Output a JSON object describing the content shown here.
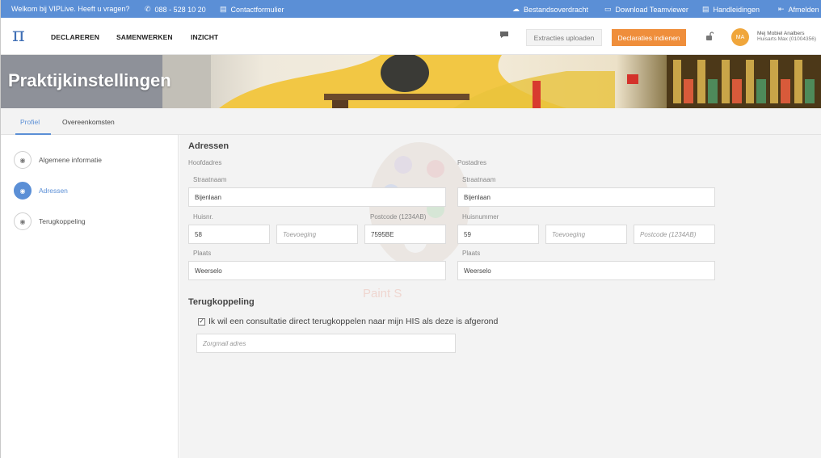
{
  "topbar": {
    "welcome": "Welkom bij VIPLive. Heeft u vragen?",
    "phone": "088 - 528 10 20",
    "contact": "Contactformulier",
    "transfer": "Bestandsoverdracht",
    "teamviewer": "Download Teamviewer",
    "manuals": "Handleidingen",
    "logout": "Afmelden"
  },
  "nav": {
    "logo": "π",
    "links": [
      "DECLAREREN",
      "SAMENWERKEN",
      "INZICHT"
    ],
    "upload_button": "Extracties uploaden",
    "submit_button": "Declaraties indienen",
    "avatar_initials": "MA",
    "user_name": "Mej Mobiel Analbers",
    "user_role": "Huisarts Max (01004356)"
  },
  "banner": {
    "title": "Praktijkinstellingen"
  },
  "tabs": [
    {
      "label": "Profiel",
      "active": true
    },
    {
      "label": "Overeenkomsten",
      "active": false
    }
  ],
  "sidebar": {
    "items": [
      {
        "label": "Algemene informatie",
        "icon": "eye-icon",
        "active": false
      },
      {
        "label": "Adressen",
        "icon": "eye-icon",
        "active": true
      },
      {
        "label": "Terugkoppeling",
        "icon": "eye-icon",
        "active": false
      }
    ]
  },
  "addresses": {
    "title": "Adressen",
    "main": {
      "heading": "Hoofdadres",
      "street_label": "Straatnaam",
      "street": "Bijenlaan",
      "number_label": "Huisnr.",
      "number": "58",
      "addition_placeholder": "Toevoeging",
      "postcode_label": "Postcode (1234AB)",
      "postcode": "7595BE",
      "city_label": "Plaats",
      "city": "Weerselo"
    },
    "postal": {
      "heading": "Postadres",
      "street_label": "Straatnaam",
      "street": "Bijenlaan",
      "number_label": "Huisnummer",
      "number": "59",
      "addition_placeholder": "Toevoeging",
      "postcode_placeholder": "Postcode (1234AB)",
      "city_label": "Plaats",
      "city": "Weerselo"
    }
  },
  "watermark": "Paint S",
  "feedback": {
    "title": "Terugkoppeling",
    "checkbox_label": "Ik wil een consultatie direct terugkoppelen naar mijn HIS als deze is afgerond",
    "checked": true,
    "email_placeholder": "Zorgmail adres"
  },
  "colors": {
    "topbar": "#5b8fd6",
    "accent": "#5b8fd6",
    "orange_button": "#ef8e3b",
    "avatar": "#f0a63b"
  }
}
